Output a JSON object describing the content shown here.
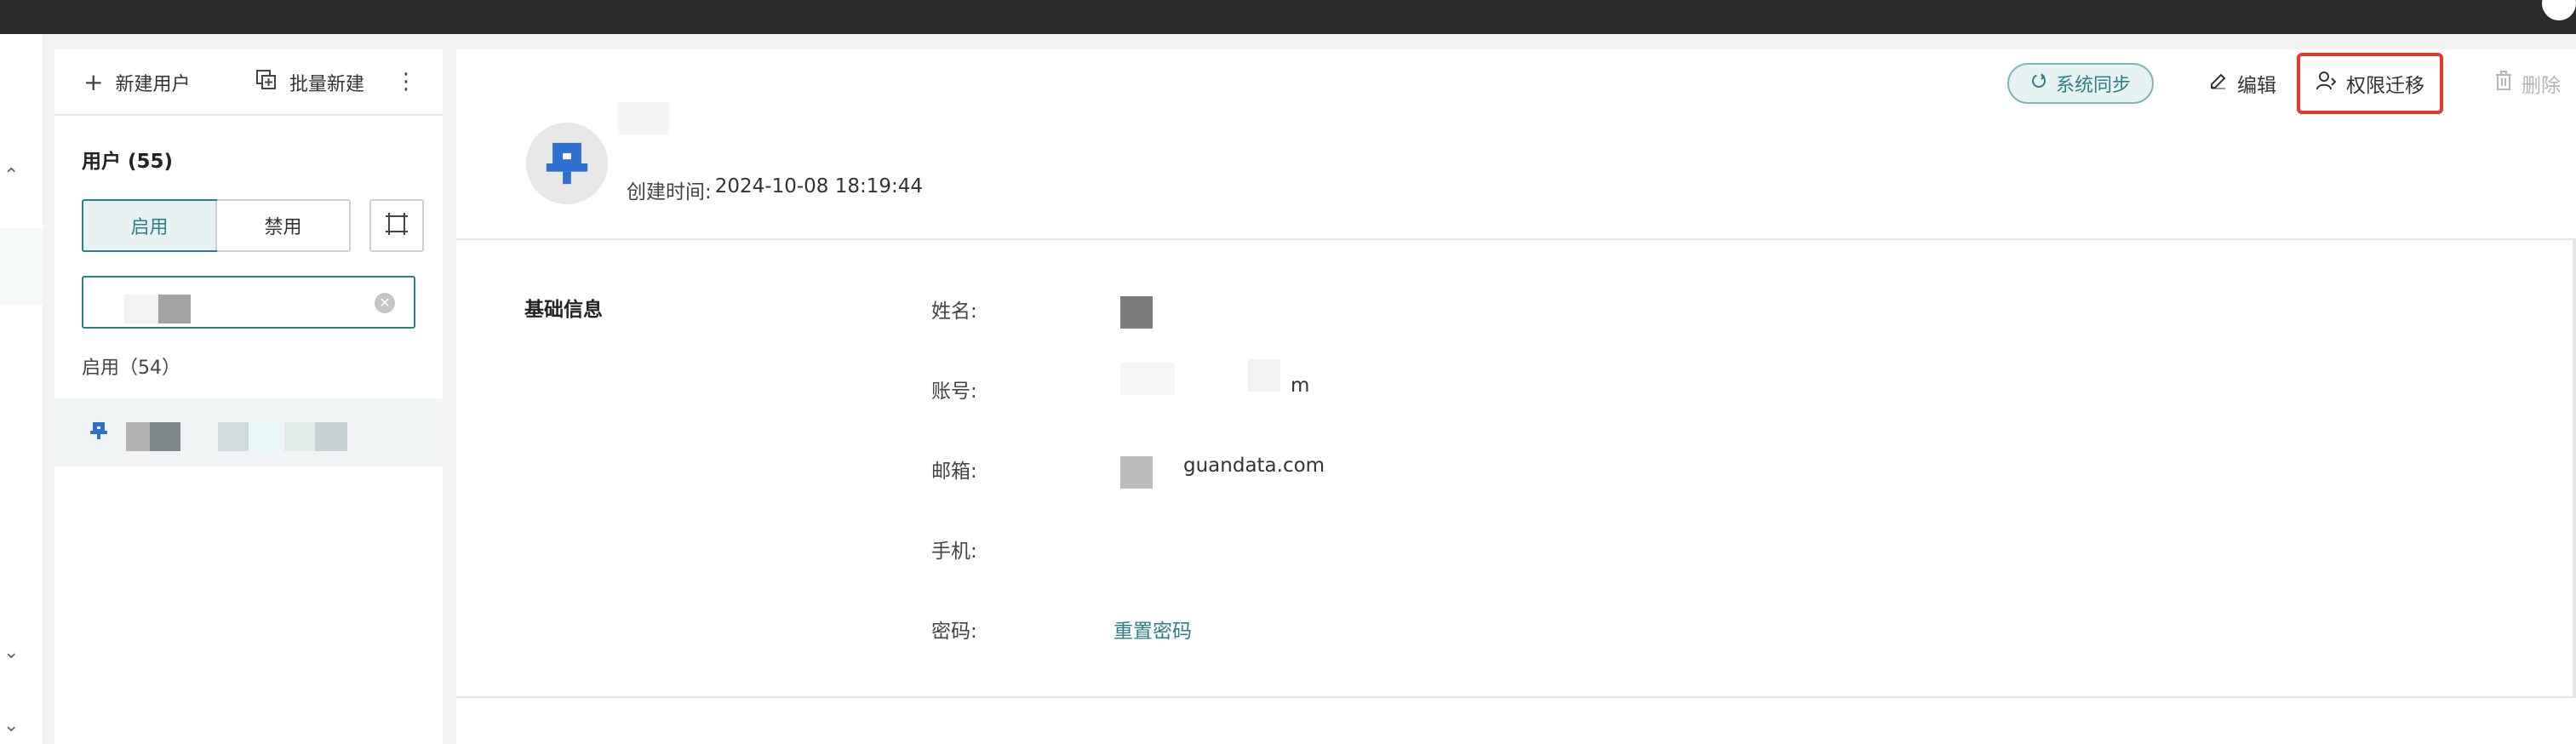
{
  "toolbar": {
    "new_user_label": "新建用户",
    "batch_create_label": "批量新建",
    "more_label": "⋮"
  },
  "user_panel": {
    "title": "用户 (55)",
    "segment": {
      "enabled_label": "启用",
      "disabled_label": "禁用",
      "active": "enabled"
    },
    "group_label": "启用（54）"
  },
  "profile": {
    "created_label": "创建时间:",
    "created_value": "2024-10-08 18:19:44"
  },
  "actions": {
    "sync_label": "系统同步",
    "edit_label": "编辑",
    "transfer_label": "权限迁移",
    "delete_label": "删除"
  },
  "basic_info": {
    "section_title": "基础信息",
    "name_label": "姓名:",
    "account_label": "账号:",
    "account_value_suffix": "m",
    "email_label": "邮箱:",
    "email_value": "guandata.com",
    "phone_label": "手机:",
    "password_label": "密码:",
    "reset_password_label": "重置密码"
  },
  "colors": {
    "accent": "#2e7f85",
    "highlight_border": "#e23a2e",
    "topbar": "#2b2c2e"
  },
  "icons": {
    "add": "plus-icon",
    "batch": "copy-add-icon",
    "filter": "filter-frame-icon",
    "clear": "clear-circle-icon",
    "sync": "sync-icon",
    "edit": "edit-icon",
    "transfer": "user-transfer-icon",
    "delete": "trash-icon"
  }
}
